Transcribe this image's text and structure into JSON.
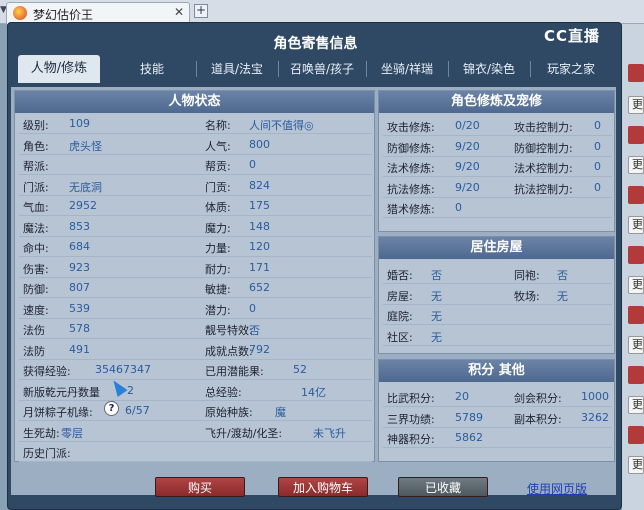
{
  "browser": {
    "tab_title": "梦幻估价王",
    "close": "✕",
    "new_tab": "+",
    "arrow": "▼"
  },
  "right_strip": {
    "btn_text": "更"
  },
  "dialog": {
    "title": "角色寄售信息",
    "logo": "CC直播"
  },
  "tabs": [
    "人物/修炼",
    "技能",
    "道具/法宝",
    "召唤兽/孩子",
    "坐骑/祥瑞",
    "锦衣/染色",
    "玩家之家"
  ],
  "status": {
    "header": "人物状态",
    "left_rows": [
      {
        "label": "级别:",
        "value": "109"
      },
      {
        "label": "角色:",
        "value": "虎头怪"
      },
      {
        "label": "帮派:",
        "value": ""
      },
      {
        "label": "门派:",
        "value": "无底洞"
      },
      {
        "label": "气血:",
        "value": "2952"
      },
      {
        "label": "魔法:",
        "value": "853"
      },
      {
        "label": "命中:",
        "value": "684"
      },
      {
        "label": "伤害:",
        "value": "923"
      },
      {
        "label": "防御:",
        "value": "807"
      },
      {
        "label": "速度:",
        "value": "539"
      },
      {
        "label": "法伤",
        "value": "578"
      },
      {
        "label": "法防",
        "value": "491"
      },
      {
        "label": "获得经验:",
        "value": "35467347"
      },
      {
        "label": "新版乾元丹数量",
        "value": "2"
      },
      {
        "label": "月饼粽子机缘:",
        "value": "6/57"
      },
      {
        "label": "生死劫:",
        "value": "零层"
      },
      {
        "label": "历史门派:",
        "value": ""
      }
    ],
    "right_rows": [
      {
        "label": "名称:",
        "value": "人间不值得◎"
      },
      {
        "label": "人气:",
        "value": "800"
      },
      {
        "label": "帮贡:",
        "value": "0"
      },
      {
        "label": "门贡:",
        "value": "824"
      },
      {
        "label": "体质:",
        "value": "175"
      },
      {
        "label": "魔力:",
        "value": "148"
      },
      {
        "label": "力量:",
        "value": "120"
      },
      {
        "label": "耐力:",
        "value": "171"
      },
      {
        "label": "敏捷:",
        "value": "652"
      },
      {
        "label": "潜力:",
        "value": "0"
      },
      {
        "label": "靓号特效:",
        "value": "否"
      },
      {
        "label": "成就点数:",
        "value": "792"
      },
      {
        "label": "已用潜能果:",
        "value": "52"
      },
      {
        "label": "总经验:",
        "value": "14亿"
      },
      {
        "label": "原始种族:",
        "value": "魔"
      },
      {
        "label": "飞升/渡劫/化圣:",
        "value": "未飞升"
      }
    ]
  },
  "cultivation": {
    "header": "角色修炼及宠修",
    "rows": [
      {
        "l1": "攻击修炼:",
        "v1": "0/20",
        "l2": "攻击控制力:",
        "v2": "0"
      },
      {
        "l1": "防御修炼:",
        "v1": "9/20",
        "l2": "防御控制力:",
        "v2": "0"
      },
      {
        "l1": "法术修炼:",
        "v1": "9/20",
        "l2": "法术控制力:",
        "v2": "0"
      },
      {
        "l1": "抗法修炼:",
        "v1": "9/20",
        "l2": "抗法控制力:",
        "v2": "0"
      },
      {
        "l1": "猎术修炼:",
        "v1": "0",
        "l2": "",
        "v2": ""
      }
    ]
  },
  "housing": {
    "header": "居住房屋",
    "rows": [
      {
        "l1": "婚否:",
        "v1": "否",
        "l2": "同袍:",
        "v2": "否"
      },
      {
        "l1": "房屋:",
        "v1": "无",
        "l2": "牧场:",
        "v2": "无"
      },
      {
        "l1": "庭院:",
        "v1": "无",
        "l2": "",
        "v2": ""
      },
      {
        "l1": "社区:",
        "v1": "无",
        "l2": "",
        "v2": ""
      }
    ]
  },
  "points": {
    "header": "积分 其他",
    "rows": [
      {
        "l1": "比武积分:",
        "v1": "20",
        "l2": "剑会积分:",
        "v2": "1000"
      },
      {
        "l1": "三界功绩:",
        "v1": "5789",
        "l2": "副本积分:",
        "v2": "3262"
      },
      {
        "l1": "神器积分:",
        "v1": "5862",
        "l2": "",
        "v2": ""
      }
    ]
  },
  "actions": {
    "buy": "购买",
    "add_cart": "加入购物车",
    "favorited": "已收藏",
    "web_link": "使用网页版"
  },
  "help_icon": "?"
}
